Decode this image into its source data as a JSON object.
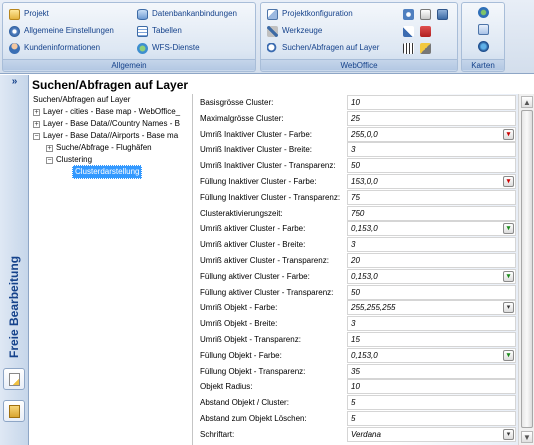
{
  "ribbon": {
    "group_allgemein": {
      "label": "Allgemein",
      "items": [
        "Projekt",
        "Allgemeine Einstellungen",
        "Kundeninformationen",
        "Datenbankanbindungen",
        "Tabellen",
        "WFS-Dienste"
      ]
    },
    "group_webOffice": {
      "label": "WebOffice",
      "items": [
        "Projektkonfiguration",
        "Werkzeuge",
        "Suchen/Abfragen auf Layer"
      ]
    },
    "group_karten": {
      "label": "Karten"
    }
  },
  "left_strip": {
    "collapse": "»",
    "vertical_label": "Freie Bearbeitung"
  },
  "panel": {
    "title": "Suchen/Abfragen auf Layer"
  },
  "tree": {
    "root": "Suchen/Abfragen auf Layer",
    "nodes": [
      {
        "exp": "+",
        "label": "Layer - cities - Base map - WebOffice_"
      },
      {
        "exp": "+",
        "label": "Layer - Base Data//Country Names - B"
      },
      {
        "exp": "−",
        "label": "Layer - Base Data//Airports - Base ma"
      },
      {
        "exp": "+",
        "label": "Suche/Abfrage - Flughäfen"
      },
      {
        "exp": "−",
        "label": "Clustering"
      },
      {
        "exp": "",
        "label": "Clusterdarstellung"
      }
    ]
  },
  "properties": [
    {
      "name": "Basisgrösse Cluster:",
      "value": "10",
      "btn": ""
    },
    {
      "name": "Maximalgrösse Cluster:",
      "value": "25",
      "btn": ""
    },
    {
      "name": "Umriß Inaktiver Cluster - Farbe:",
      "value": "255,0,0",
      "btn": "red"
    },
    {
      "name": "Umriß Inaktiver Cluster - Breite:",
      "value": "3",
      "btn": ""
    },
    {
      "name": "Umriß Inaktiver Cluster - Transparenz:",
      "value": "50",
      "btn": ""
    },
    {
      "name": "Füllung Inaktiver Cluster - Farbe:",
      "value": "153,0,0",
      "btn": "red"
    },
    {
      "name": "Füllung Inaktiver Cluster - Transparenz:",
      "value": "75",
      "btn": ""
    },
    {
      "name": "Clusteraktivierungszeit:",
      "value": "750",
      "btn": ""
    },
    {
      "name": "Umriß aktiver Cluster - Farbe:",
      "value": "0,153,0",
      "btn": "green"
    },
    {
      "name": "Umriß aktiver Cluster - Breite:",
      "value": "3",
      "btn": ""
    },
    {
      "name": "Umriß aktiver Cluster - Transparenz:",
      "value": "20",
      "btn": ""
    },
    {
      "name": "Füllung aktiver Cluster - Farbe:",
      "value": "0,153,0",
      "btn": "green"
    },
    {
      "name": "Füllung aktiver Cluster - Transparenz:",
      "value": "50",
      "btn": ""
    },
    {
      "name": "Umriß Objekt - Farbe:",
      "value": "255,255,255",
      "btn": "plain"
    },
    {
      "name": "Umriß Objekt - Breite:",
      "value": "3",
      "btn": ""
    },
    {
      "name": "Umriß Objekt - Transparenz:",
      "value": "15",
      "btn": ""
    },
    {
      "name": "Füllung Objekt - Farbe:",
      "value": "0,153,0",
      "btn": "green"
    },
    {
      "name": "Füllung Objekt - Transparenz:",
      "value": "35",
      "btn": ""
    },
    {
      "name": "Objekt Radius:",
      "value": "10",
      "btn": ""
    },
    {
      "name": "Abstand Objekt / Cluster:",
      "value": "5",
      "btn": ""
    },
    {
      "name": "Abstand zum Objekt Löschen:",
      "value": "5",
      "btn": ""
    },
    {
      "name": "Schriftart:",
      "value": "Verdana",
      "btn": "plain"
    }
  ],
  "colors": {
    "accent": "#15428b",
    "selection": "#3399ff",
    "ribbon_bg": "#dde7f3"
  }
}
